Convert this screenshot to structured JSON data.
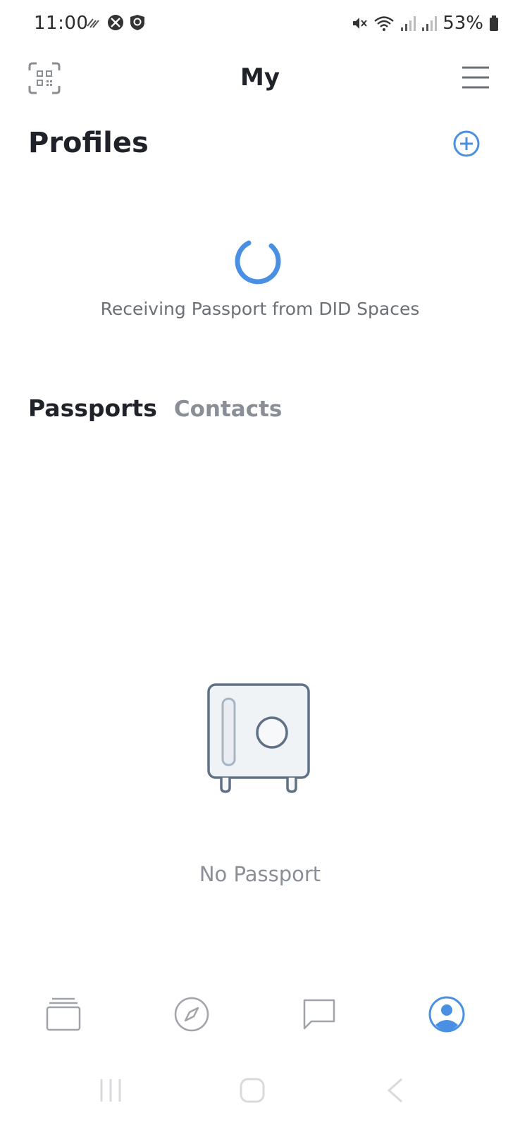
{
  "status_bar": {
    "time": "11:00",
    "left_icons": [
      "activity-icon",
      "xbox-icon",
      "shield-icon"
    ],
    "right_icons": [
      "mute-icon",
      "wifi-icon",
      "signal-icon",
      "signal-icon",
      "battery-icon"
    ],
    "battery": "53%"
  },
  "header": {
    "title": "My",
    "left_icon": "qr-scan-icon",
    "right_icon": "menu-icon"
  },
  "profiles": {
    "title": "Profiles",
    "add_icon": "add-circle-icon",
    "loading_text": "Receiving Passport from DID Spaces"
  },
  "tabs": [
    {
      "label": "Passports",
      "active": true
    },
    {
      "label": "Contacts",
      "active": false
    }
  ],
  "empty_state": {
    "icon": "safe-icon",
    "text": "No Passport"
  },
  "bottom_nav": [
    {
      "icon": "cards-icon",
      "active": false
    },
    {
      "icon": "compass-icon",
      "active": false
    },
    {
      "icon": "chat-icon",
      "active": false
    },
    {
      "icon": "profile-icon",
      "active": true
    }
  ],
  "colors": {
    "accent": "#4a90e2",
    "text_primary": "#1f2329",
    "text_secondary": "#8a8e96",
    "icon_gray": "#a0a4aa"
  }
}
